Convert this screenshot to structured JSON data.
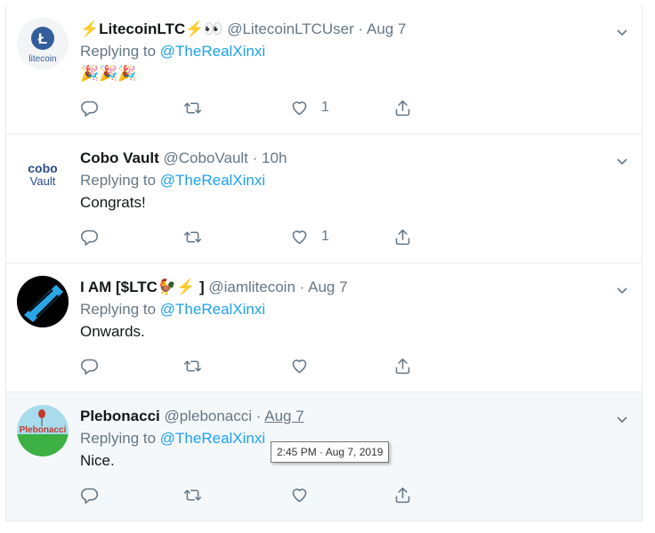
{
  "tweets": [
    {
      "name_prefix": "⚡",
      "name": "LitecoinLTC",
      "name_suffix": "⚡👀",
      "handle": "@LitecoinLTCUser",
      "sep": "·",
      "time": "Aug 7",
      "replying_prefix": "Replying to ",
      "replying_to": "@TheRealXinxi",
      "text": "🎉🎉🎉",
      "reply_count": "",
      "retweet_count": "",
      "like_count": "1",
      "avatar_text": "litecoin"
    },
    {
      "name": "Cobo Vault",
      "handle": "@CoboVault",
      "sep": "·",
      "time": "10h",
      "replying_prefix": "Replying to ",
      "replying_to": "@TheRealXinxi",
      "text": "Congrats!",
      "like_count": "1",
      "avatar_text_top": "cobo",
      "avatar_text_bottom": "Vault"
    },
    {
      "name": "I AM [$LTC",
      "name_suffix": "🐓⚡ ]",
      "handle": "@iamlitecoin",
      "sep": "·",
      "time": "Aug 7",
      "replying_prefix": "Replying to ",
      "replying_to": "@TheRealXinxi",
      "text": "Onwards.",
      "like_count": ""
    },
    {
      "name": "Plebonacci",
      "handle": "@plebonacci",
      "sep": "·",
      "time": "Aug 7",
      "replying_prefix": "Replying to ",
      "replying_to": "@TheRealXinxi",
      "text": "Nice.",
      "like_count": "",
      "avatar_text": "Plebonacci"
    }
  ],
  "tooltip": "2:45 PM · Aug 7, 2019",
  "icons": [
    "reply-icon",
    "retweet-icon",
    "like-icon",
    "share-icon",
    "chevron-down-icon"
  ],
  "colors": {
    "link": "#1da1f2",
    "muted": "#657786",
    "hover_bg": "#f5f8fa",
    "border": "#e6ecf0"
  }
}
